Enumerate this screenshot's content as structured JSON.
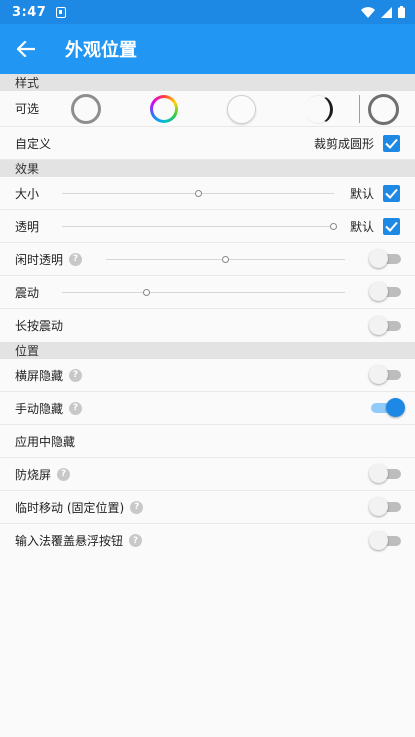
{
  "status": {
    "time": "3:47"
  },
  "appbar": {
    "title": "外观位置"
  },
  "sections": {
    "style": "样式",
    "effect": "效果",
    "position": "位置"
  },
  "style": {
    "selectable_label": "可选",
    "custom_label": "自定义",
    "crop_circle_label": "裁剪成圆形",
    "crop_circle_checked": true
  },
  "effect": {
    "size": {
      "label": "大小",
      "value": 0.5,
      "default_label": "默认",
      "default_checked": true
    },
    "opacity": {
      "label": "透明",
      "value": 1.0,
      "default_label": "默认",
      "default_checked": true
    },
    "idle_opacity": {
      "label": "闲时透明",
      "value": 0.5,
      "enabled": false
    },
    "vibrate": {
      "label": "震动",
      "value": 0.3,
      "enabled": false
    },
    "long_press_vibrate": {
      "label": "长按震动",
      "enabled": false
    }
  },
  "position": {
    "landscape_hide": {
      "label": "横屏隐藏",
      "enabled": false
    },
    "manual_hide": {
      "label": "手动隐藏",
      "enabled": true
    },
    "in_app_hide": {
      "label": "应用中隐藏"
    },
    "anti_burn": {
      "label": "防烧屏",
      "enabled": false
    },
    "temp_move": {
      "label": "临时移动 (固定位置)",
      "enabled": false
    },
    "ime_cover": {
      "label": "输入法覆盖悬浮按钮",
      "enabled": false
    }
  },
  "colors": {
    "primary": "#2196f3",
    "primary_dark": "#1e88e5",
    "switch_on_track": "#90caf9"
  }
}
